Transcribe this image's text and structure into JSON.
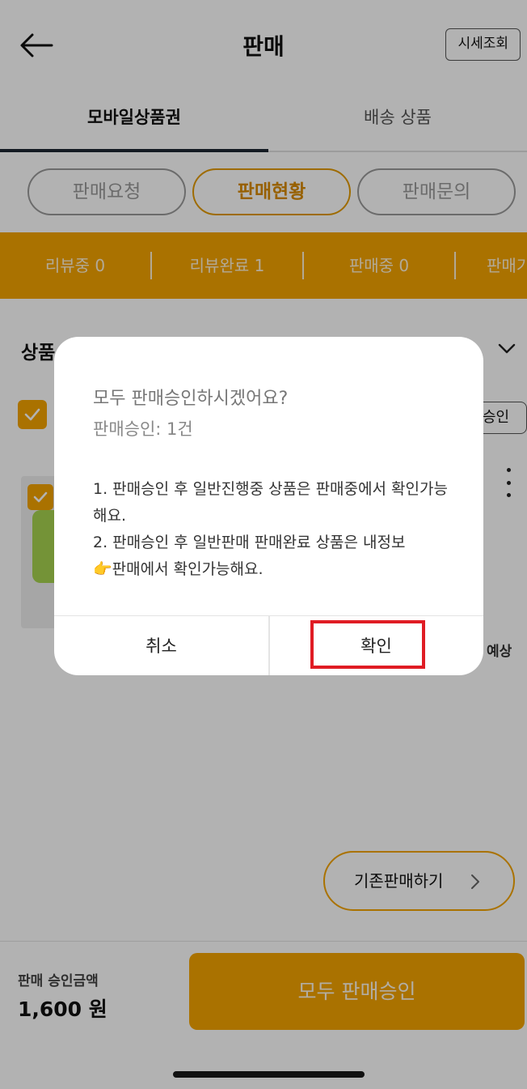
{
  "header": {
    "title": "판매",
    "price_button": "시세조회"
  },
  "tabs": [
    {
      "label": "모바일상품권",
      "active": true
    },
    {
      "label": "배송 상품",
      "active": false
    }
  ],
  "pills": [
    {
      "label": "판매요청",
      "active": false
    },
    {
      "label": "판매현황",
      "active": true
    },
    {
      "label": "판매문의",
      "active": false
    }
  ],
  "status_bar": {
    "items": [
      "리뷰중 0",
      "리뷰완료 1",
      "판매중 0",
      "판매기"
    ]
  },
  "content": {
    "section_title": "상품",
    "approve_mini_button": "승인",
    "expected_text": "t 예상"
  },
  "existing_sale_button": "기존판매하기",
  "bottom": {
    "amount_label": "판매 승인금액",
    "amount_value": "1,600 원",
    "approve_all_button": "모두 판매승인"
  },
  "dialog": {
    "title": "모두 판매승인하시겠어요?",
    "count": "판매승인: 1건",
    "line1": "1. 판매승인 후 일반진행중 상품은 판매중에서 확인가능해요.",
    "line2": "2. 판매승인 후 일반판매 판매완료 상품은 내정보",
    "line2b": "👉판매에서 확인가능해요.",
    "cancel": "취소",
    "confirm": "확인"
  },
  "colors": {
    "accent": "#f4a400",
    "highlight": "#e01c24"
  }
}
